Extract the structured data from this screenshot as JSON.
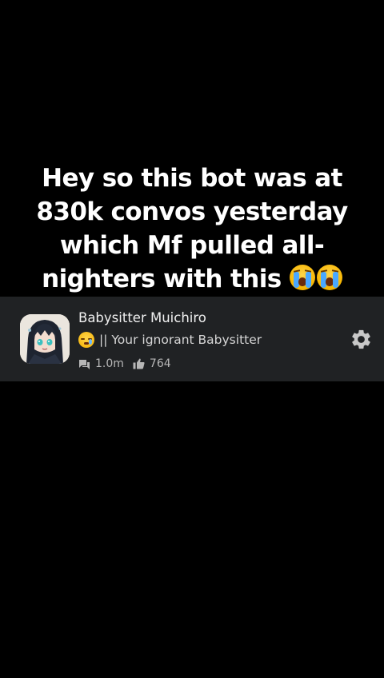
{
  "caption": {
    "text": "Hey so this bot was at 830k convos yesterday which Mf pulled all-nighters with this"
  },
  "bot": {
    "name": "Babysitter Muichiro",
    "tagline": "|| Your ignorant Babysitter",
    "chats": "1.0m",
    "likes": "764"
  },
  "icons": {
    "caption_emoji": "loudly-crying-face-emoji",
    "tagline_emoji": "sleepy-face-emoji",
    "chats": "chat-bubble-icon",
    "likes": "thumbs-up-icon",
    "settings": "gear-icon"
  },
  "colors": {
    "background": "#000000",
    "card": "#202224",
    "text": "#f0f0f0",
    "muted": "#b7b7b7"
  }
}
